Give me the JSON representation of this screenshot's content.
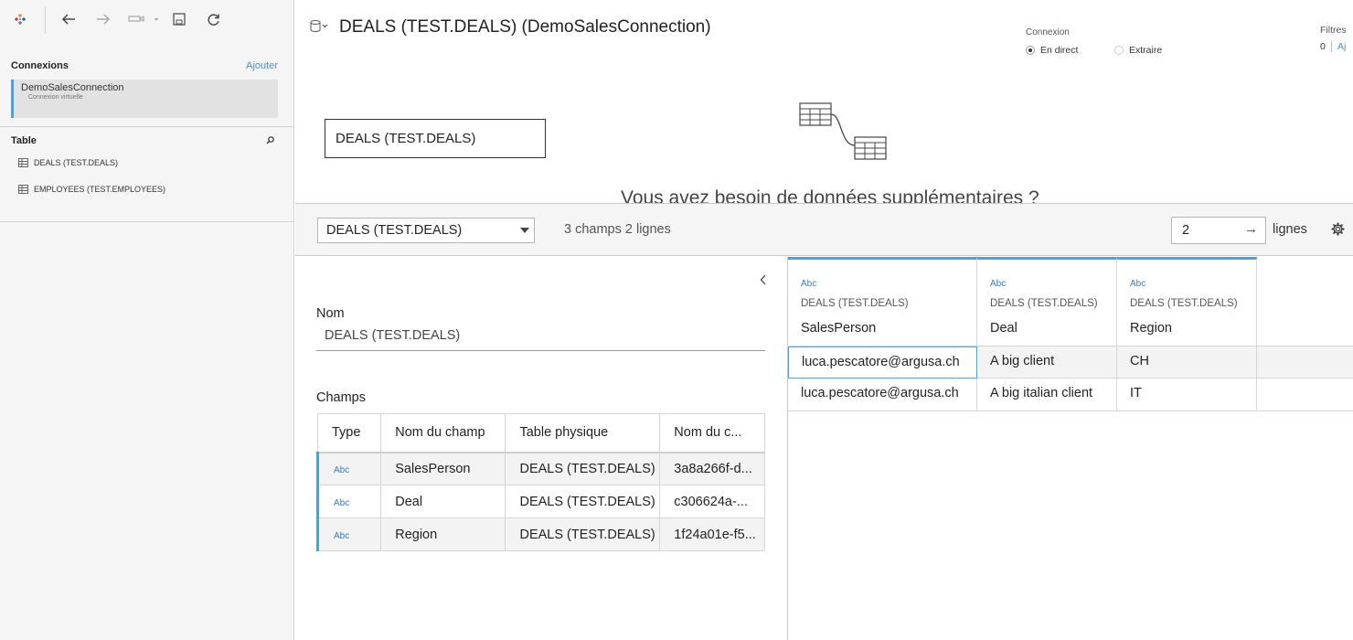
{
  "left": {
    "connections_title": "Connexions",
    "add_label": "Ajouter",
    "connection": {
      "name": "DemoSalesConnection",
      "subtitle": "Connexion virtuelle"
    },
    "table_title": "Table",
    "tables": [
      "DEALS (TEST.DEALS)",
      "EMPLOYEES (TEST.EMPLOYEES)"
    ]
  },
  "canvas": {
    "datasource_title": "DEALS (TEST.DEALS) (DemoSalesConnection)",
    "connection_label": "Connexion",
    "live_label": "En direct",
    "extract_label": "Extraire",
    "filters_label": "Filtres",
    "filters_count": "0",
    "filters_add": "Aj",
    "logical_table": "DEALS (TEST.DEALS)",
    "need_more": "Vous avez besoin de données supplémentaires ?"
  },
  "bar": {
    "selected_table": "DEALS (TEST.DEALS)",
    "fields_rows": "3 champs 2 lignes",
    "rows_value": "2",
    "rows_label": "lignes"
  },
  "meta": {
    "name_label": "Nom",
    "name_value": "DEALS (TEST.DEALS)",
    "fields_label": "Champs",
    "columns": [
      "Type",
      "Nom du champ",
      "Table physique",
      "Nom du c..."
    ],
    "rows": [
      {
        "type": "Abc",
        "field": "SalesPerson",
        "table": "DEALS (TEST.DEALS)",
        "remote": "3a8a266f-d..."
      },
      {
        "type": "Abc",
        "field": "Deal",
        "table": "DEALS (TEST.DEALS)",
        "remote": "c306624a-..."
      },
      {
        "type": "Abc",
        "field": "Region",
        "table": "DEALS (TEST.DEALS)",
        "remote": "1f24a01e-f5..."
      }
    ]
  },
  "grid": {
    "columns": [
      {
        "type": "Abc",
        "source": "DEALS (TEST.DEALS)",
        "name": "SalesPerson"
      },
      {
        "type": "Abc",
        "source": "DEALS (TEST.DEALS)",
        "name": "Deal"
      },
      {
        "type": "Abc",
        "source": "DEALS (TEST.DEALS)",
        "name": "Region"
      }
    ],
    "rows": [
      [
        "luca.pescatore@argusa.ch",
        "A big client",
        "CH"
      ],
      [
        "luca.pescatore@argusa.ch",
        "A big italian client",
        "IT"
      ]
    ]
  },
  "colors": {
    "accent": "#5a9bd0",
    "link": "#4a90c2",
    "panel": "#f5f5f5"
  }
}
